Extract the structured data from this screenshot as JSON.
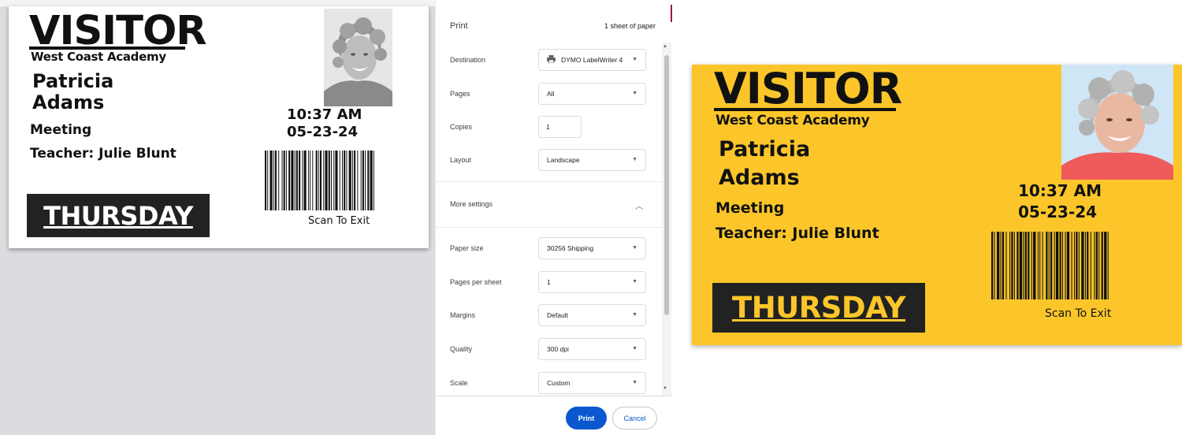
{
  "preview": {
    "badge": {
      "visitor": "VISITOR",
      "academy": "West Coast Academy",
      "first_name": "Patricia",
      "last_name": "Adams",
      "purpose": "Meeting",
      "host": "Teacher: Julie Blunt",
      "time": "10:37 AM",
      "date": "05-23-24",
      "day": "THURSDAY",
      "scan_text": "Scan To Exit",
      "day_color": "#ffffff"
    }
  },
  "print_panel": {
    "title": "Print",
    "sheet_count": "1 sheet of paper",
    "destination": {
      "label": "Destination",
      "value": "DYMO LabelWriter 4"
    },
    "pages": {
      "label": "Pages",
      "value": "All"
    },
    "copies": {
      "label": "Copies",
      "value": "1"
    },
    "layout": {
      "label": "Layout",
      "value": "Landscape"
    },
    "more_settings": {
      "label": "More settings"
    },
    "paper_size": {
      "label": "Paper size",
      "value": "30256 Shipping"
    },
    "pages_per_sheet": {
      "label": "Pages per sheet",
      "value": "1"
    },
    "margins": {
      "label": "Margins",
      "value": "Default"
    },
    "quality": {
      "label": "Quality",
      "value": "300 dpi"
    },
    "scale": {
      "label": "Scale",
      "value": "Custom"
    },
    "print_label": "Print",
    "cancel_label": "Cancel",
    "accent_color": "#0b57d0"
  },
  "color_badge": {
    "visitor": "VISITOR",
    "academy": "West Coast Academy",
    "first_name": "Patricia",
    "last_name": "Adams",
    "purpose": "Meeting",
    "host": "Teacher: Julie Blunt",
    "time": "10:37 AM",
    "date": "05-23-24",
    "day": "THURSDAY",
    "scan_text": "Scan To Exit",
    "background_color": "#fcc62a",
    "day_color": "#fcc62a"
  }
}
